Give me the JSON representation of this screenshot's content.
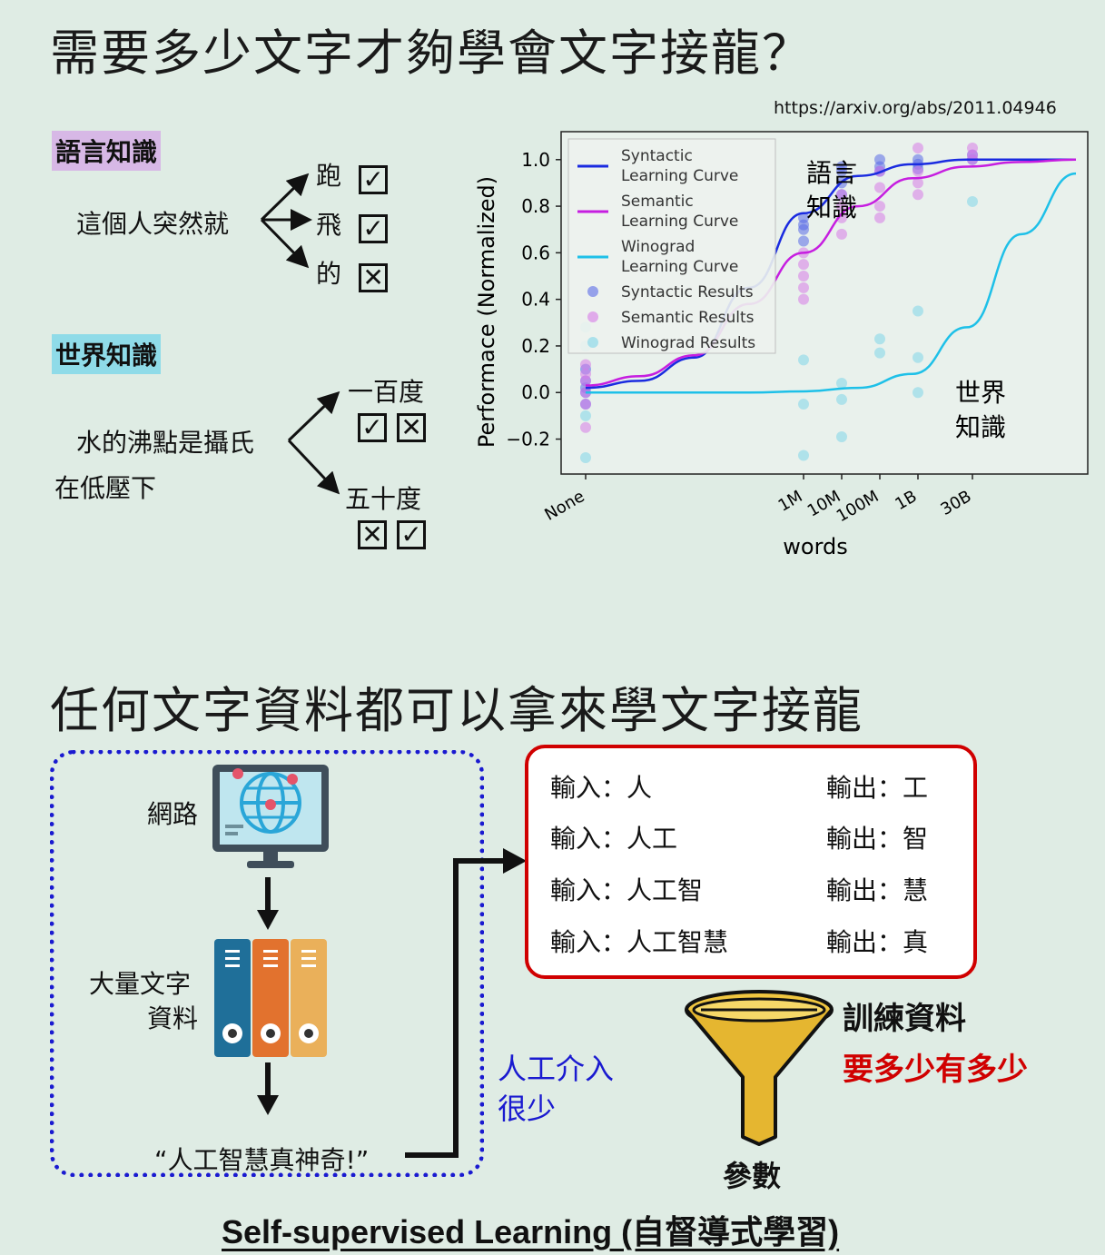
{
  "top": {
    "title": "需要多少文字才夠學會文字接龍？",
    "url": "https://arxiv.org/abs/2011.04946",
    "language_tag": "語言知識",
    "language_sentence": "這個人突然就",
    "language_options": [
      {
        "word": "跑",
        "mark": "✓"
      },
      {
        "word": "飛",
        "mark": "✓"
      },
      {
        "word": "的",
        "mark": "✕"
      }
    ],
    "world_tag": "世界知識",
    "world_sentence_line1": "水的沸點是攝氏",
    "world_sentence_line2": "在低壓下",
    "world_options": [
      {
        "word": "一百度",
        "marks": [
          "✓",
          "✕"
        ]
      },
      {
        "word": "五十度",
        "marks": [
          "✕",
          "✓"
        ]
      }
    ]
  },
  "chart_data": {
    "type": "line",
    "title": "",
    "xlabel": "words",
    "ylabel": "Performace (Normalized)",
    "x_ticks": [
      "None",
      "1M",
      "10M",
      "100M",
      "1B",
      "30B"
    ],
    "y_ticks": [
      "−0.2",
      "0.0",
      "0.2",
      "0.4",
      "0.6",
      "0.8",
      "1.0"
    ],
    "ylim": [
      -0.35,
      1.12
    ],
    "legend_position": "top-left",
    "series": [
      {
        "name": "Syntactic\nLearning Curve",
        "color": "#1a2be0",
        "kind": "line",
        "x": [
          0,
          1,
          2,
          3,
          4,
          5,
          6,
          7,
          8,
          9
        ],
        "y": [
          0.02,
          0.05,
          0.15,
          0.45,
          0.77,
          0.93,
          0.98,
          1.0,
          1.0,
          1.0
        ]
      },
      {
        "name": "Semantic\nLearning Curve",
        "color": "#c61ee0",
        "kind": "line",
        "x": [
          0,
          1,
          2,
          3,
          4,
          5,
          6,
          7,
          8,
          9
        ],
        "y": [
          0.03,
          0.07,
          0.16,
          0.38,
          0.6,
          0.8,
          0.92,
          0.97,
          0.99,
          1.0
        ]
      },
      {
        "name": "Winograd\nLearning Curve",
        "color": "#1ec0e8",
        "kind": "line",
        "x": [
          0,
          1,
          2,
          3,
          4,
          5,
          6,
          7,
          8,
          9
        ],
        "y": [
          0.0,
          0.0,
          0.0,
          0.0,
          0.005,
          0.02,
          0.08,
          0.28,
          0.68,
          0.94
        ]
      },
      {
        "name": "Syntactic Results",
        "color": "#5a6ae8",
        "kind": "scatter",
        "x": [
          0,
          0,
          0,
          0,
          0,
          4,
          4,
          4,
          4,
          4.7,
          4.7,
          4.7,
          4.7,
          5.4,
          5.4,
          5.4,
          6.1,
          6.1,
          6.1,
          7.1,
          7.1
        ],
        "y": [
          0.0,
          0.05,
          -0.05,
          0.1,
          0.02,
          0.75,
          0.7,
          0.65,
          0.72,
          0.95,
          0.9,
          0.85,
          0.97,
          1.0,
          0.97,
          0.95,
          1.0,
          0.98,
          0.96,
          1.0,
          1.02
        ]
      },
      {
        "name": "Semantic Results",
        "color": "#d77ae8",
        "kind": "scatter",
        "x": [
          0,
          0,
          0,
          0,
          0,
          0,
          4,
          4,
          4,
          4,
          4,
          4.7,
          4.7,
          4.7,
          4.7,
          5.4,
          5.4,
          5.4,
          5.4,
          6.1,
          6.1,
          6.1,
          6.1,
          7.1,
          7.1,
          7.1
        ],
        "y": [
          0.05,
          -0.05,
          0.12,
          -0.15,
          0.0,
          0.08,
          0.55,
          0.5,
          0.45,
          0.4,
          0.6,
          0.85,
          0.75,
          0.68,
          0.8,
          0.95,
          0.88,
          0.8,
          0.75,
          1.05,
          0.95,
          0.9,
          0.85,
          1.05,
          1.0,
          1.02
        ]
      },
      {
        "name": "Winograd Results",
        "color": "#7fd6ea",
        "kind": "scatter",
        "x": [
          0,
          0,
          0,
          0,
          4,
          4,
          4,
          4.7,
          4.7,
          4.7,
          5.4,
          5.4,
          6.1,
          6.1,
          6.1,
          7.1
        ],
        "y": [
          0.28,
          -0.28,
          0.2,
          -0.1,
          0.14,
          -0.05,
          -0.27,
          0.04,
          -0.03,
          -0.19,
          0.23,
          0.17,
          0.35,
          0.15,
          0.0,
          0.82
        ]
      }
    ],
    "annotations": [
      "語言\n知識",
      "世界\n知識"
    ]
  },
  "bottom": {
    "title": "任何文字資料都可以拿來學文字接龍",
    "web_label": "網路",
    "corpus_label_line1": "大量文字",
    "corpus_label_line2": "資料",
    "quote": "“人工智慧真神奇!”",
    "note_line1": "人工介入",
    "note_line2": "很少",
    "pairs": [
      {
        "input": "輸入：人",
        "output": "輸出：工"
      },
      {
        "input": "輸入：人工",
        "output": "輸出：智"
      },
      {
        "input": "輸入：人工智",
        "output": "輸出：慧"
      },
      {
        "input": "輸入：人工智慧",
        "output": "輸出：真"
      }
    ],
    "training_label": "訓練資料",
    "training_note": "要多少有多少",
    "params_label": "參數",
    "footer": "Self-supervised Learning (自督導式學習)"
  }
}
